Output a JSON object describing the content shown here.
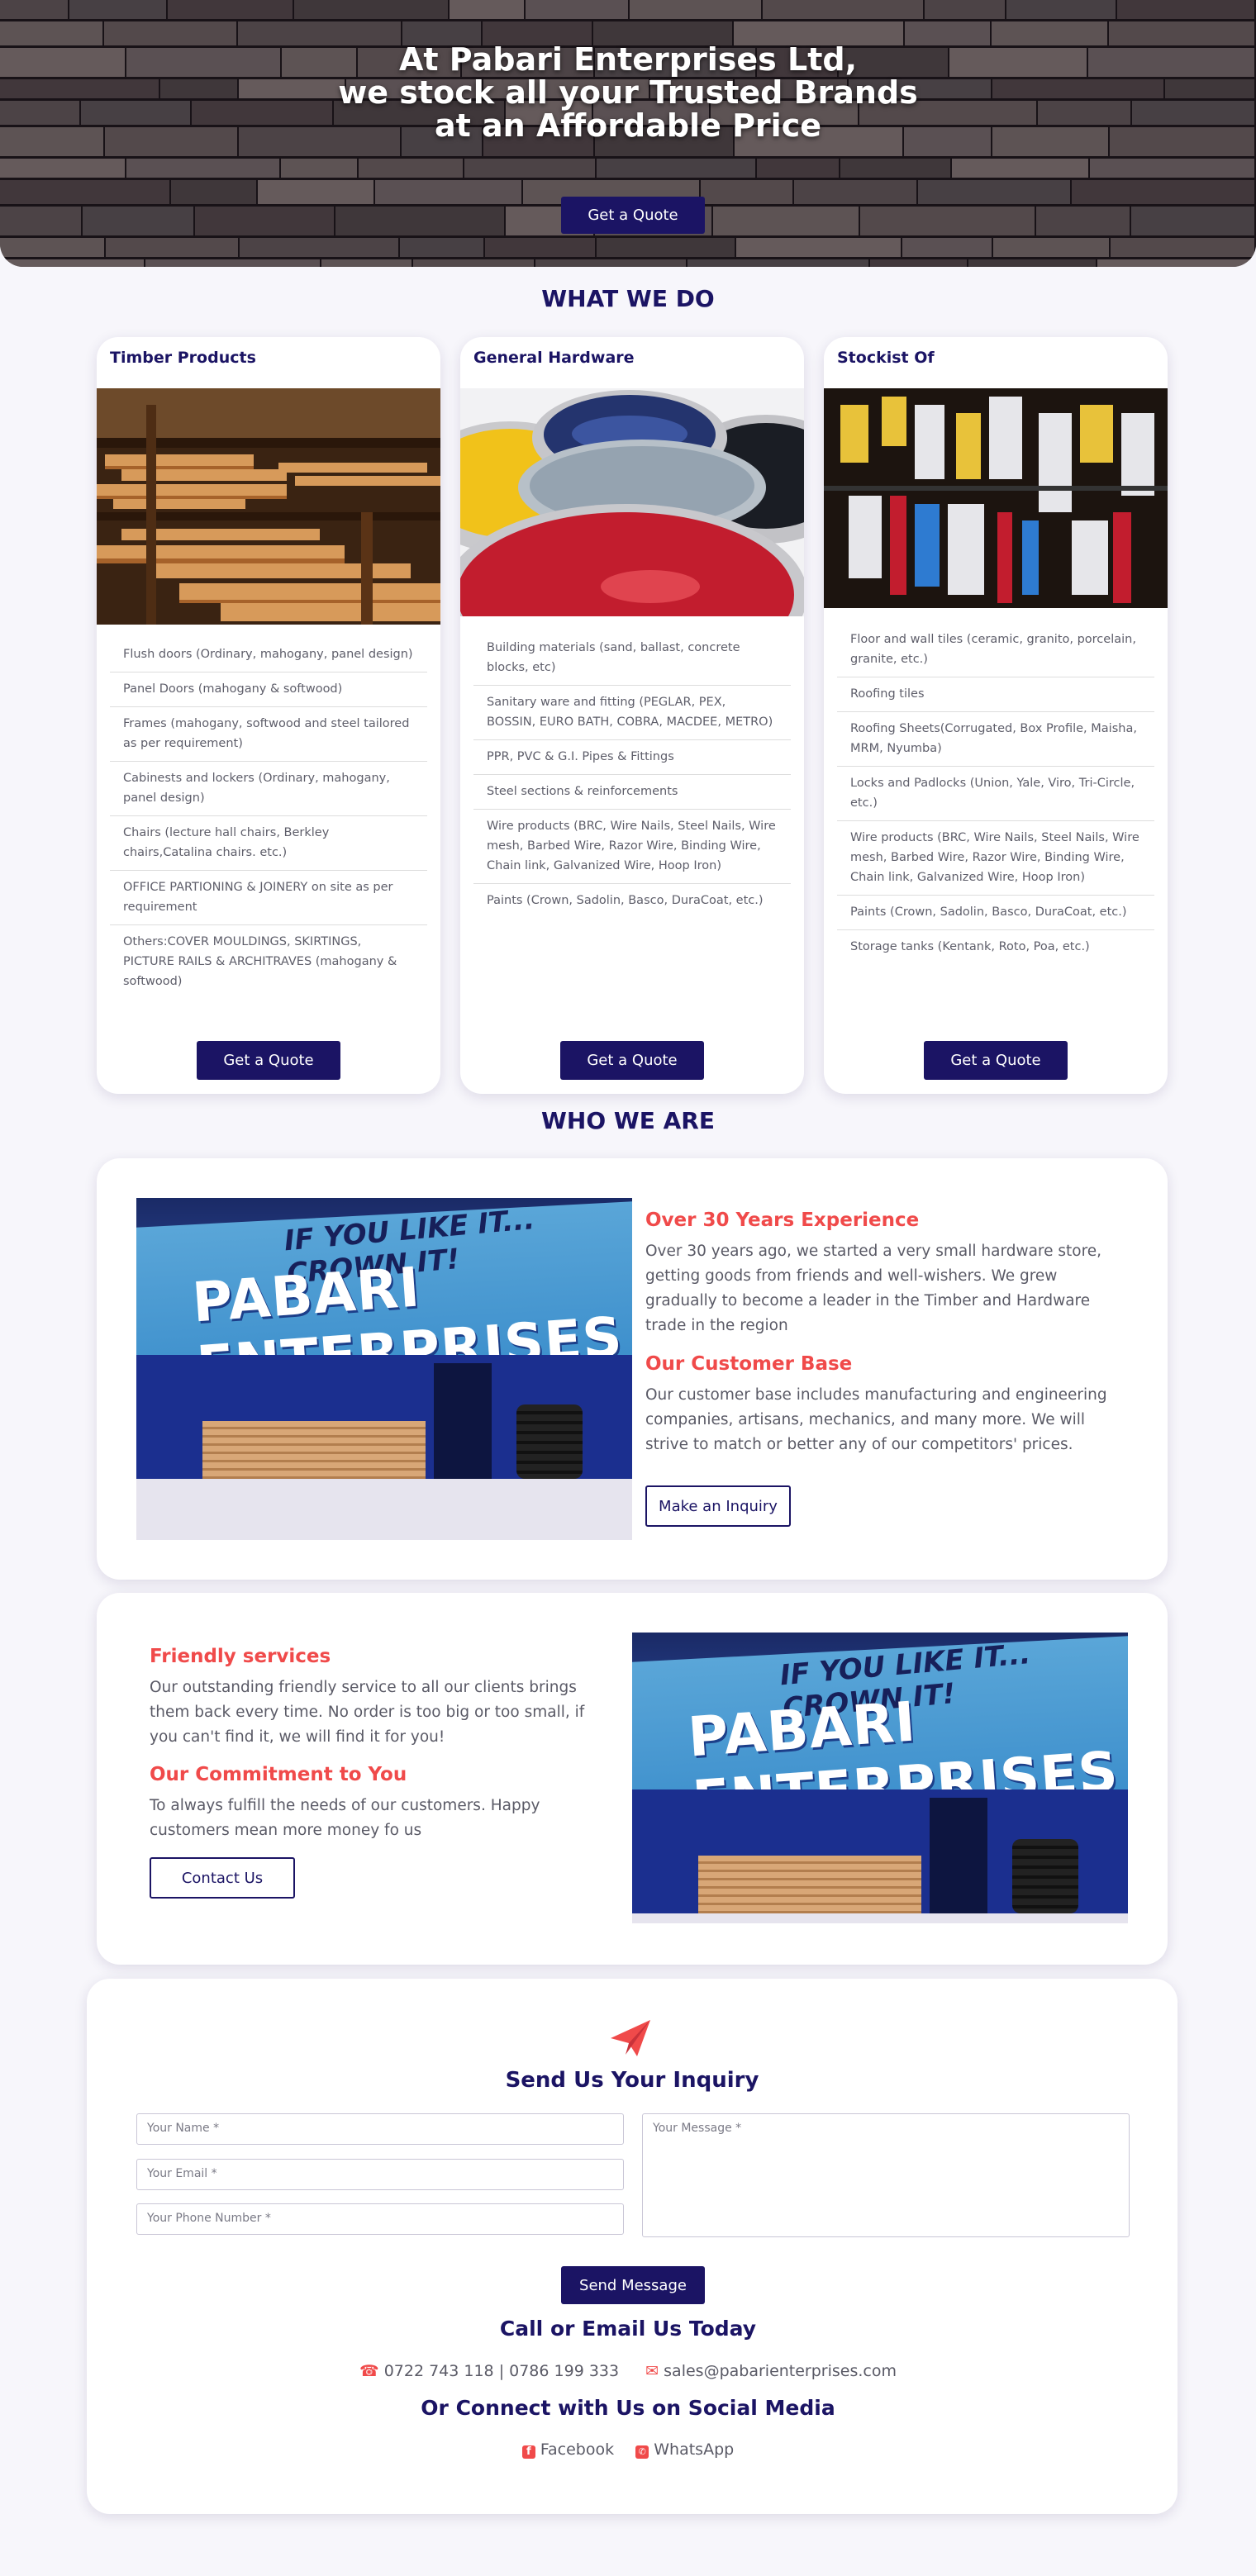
{
  "hero": {
    "title_line1": "At Pabari Enterprises Ltd,",
    "title_line2": "we stock all your Trusted Brands",
    "title_line3": "at an Affordable Price",
    "cta": "Get a Quote"
  },
  "what_we_do": {
    "heading": "WHAT WE DO",
    "cards": [
      {
        "title": "Timber Products",
        "items": [
          "Flush doors (Ordinary, mahogany, panel design)",
          "Panel Doors (mahogany & softwood)",
          "Frames (mahogany, softwood and steel tailored as per requirement)",
          "Cabinests and lockers (Ordinary, mahogany, panel design)",
          "Chairs (lecture hall chairs, Berkley chairs,Catalina chairs. etc.)",
          "OFFICE PARTIONING & JOINERY on site as per requirement",
          "Others:COVER MOULDINGS, SKIRTINGS, PICTURE RAILS & ARCHITRAVES (mahogany & softwood)"
        ],
        "cta": "Get a Quote"
      },
      {
        "title": "General Hardware",
        "items": [
          "Building materials (sand, ballast, concrete blocks, etc)",
          "Sanitary ware and fitting (PEGLAR, PEX, BOSSIN, EURO BATH, COBRA, MACDEE, METRO)",
          "PPR, PVC & G.I. Pipes & Fittings",
          "Steel sections & reinforcements",
          "Wire products (BRC, Wire Nails, Steel Nails, Wire mesh, Barbed Wire, Razor Wire, Binding Wire, Chain link, Galvanized Wire, Hoop Iron)",
          "Paints (Crown, Sadolin, Basco, DuraCoat, etc.)"
        ],
        "cta": "Get a Quote"
      },
      {
        "title": "Stockist Of",
        "items": [
          "Floor and wall tiles (ceramic, granito, porcelain, granite, etc.)",
          "Roofing tiles",
          "Roofing Sheets(Corrugated, Box Profile, Maisha, MRM, Nyumba)",
          "Locks and Padlocks (Union, Yale, Viro, Tri-Circle, etc.)",
          "Wire products (BRC, Wire Nails, Steel Nails, Wire mesh, Barbed Wire, Razor Wire, Binding Wire, Chain link, Galvanized Wire, Hoop Iron)",
          "Paints (Crown, Sadolin, Basco, DuraCoat, etc.)",
          "Storage tanks (Kentank, Roto, Poa, etc.)"
        ],
        "cta": "Get a Quote"
      }
    ]
  },
  "who_we_are": {
    "heading": "WHO WE ARE",
    "store_sign_top": "IF YOU LIKE IT... CROWN IT!",
    "store_sign_name": "PABARI ENTERPRISES",
    "block1": {
      "h1": "Over 30 Years Experience",
      "p1": "Over 30 years ago, we started a very small hardware store, getting goods from friends and well-wishers. We grew gradually to become a leader in the Timber and Hardware trade in the region",
      "h2": "Our Customer Base",
      "p2": "Our customer base includes manufacturing and engineering companies, artisans, mechanics, and many more. We will strive to match or better any of our competitors' prices.",
      "cta": "Make an Inquiry"
    },
    "block2": {
      "h1": "Friendly services",
      "p1": "Our outstanding friendly service to all our clients brings them back every time. No order is too big or too small, if you can't find it, we will find it for you!",
      "h2": "Our Commitment to You",
      "p2": "To always fulfill the needs of our customers. Happy customers mean more money fo us",
      "cta": "Contact Us"
    }
  },
  "inquiry": {
    "heading": "Send Us Your Inquiry",
    "name_placeholder": "Your Name *",
    "email_placeholder": "Your Email *",
    "phone_placeholder": "Your Phone Number *",
    "message_placeholder": "Your Message *",
    "submit": "Send Message",
    "call_heading": "Call or Email Us Today",
    "phones": "0722 743 118 | 0786 199 333",
    "email": "sales@pabarienterprises.com",
    "social_heading": "Or Connect with Us on Social Media",
    "facebook": "Facebook",
    "whatsapp": "WhatsApp"
  },
  "colors": {
    "brand_navy": "#1b1464",
    "accent_red": "#f04a4a",
    "page_bg": "#f7f6fb"
  }
}
